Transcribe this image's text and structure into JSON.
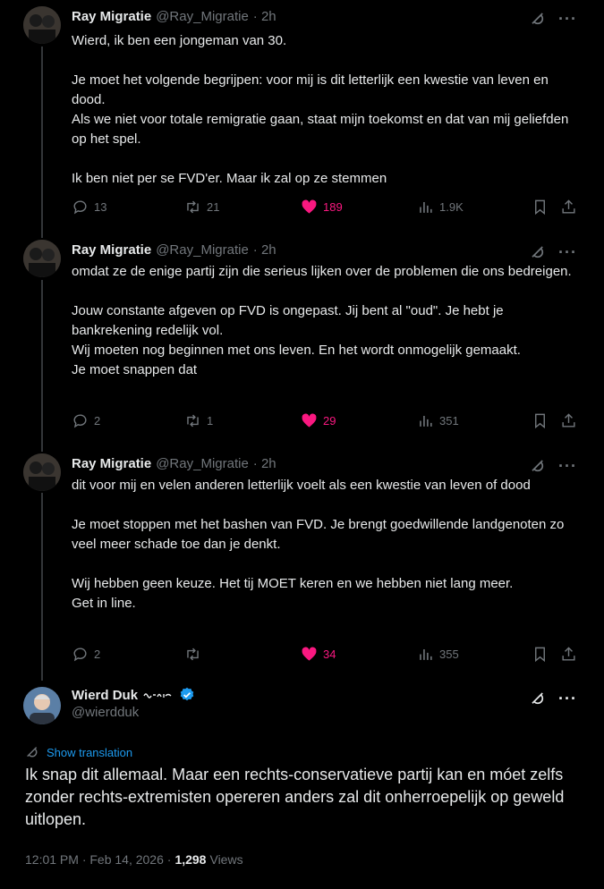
{
  "replies": [
    {
      "name": "Ray Migratie",
      "handle": "@Ray_Migratie",
      "time": "· 2h",
      "paragraphs": [
        "Wierd, ik ben een jongeman van 30.",
        "Je moet het volgende begrijpen: voor mij is dit letterlijk een kwestie van leven en dood.\nAls we niet voor totale remigratie gaan, staat mijn toekomst en dat van mij geliefden op het spel.",
        "Ik ben niet per se FVD'er. Maar ik zal op ze stemmen"
      ],
      "replies_count": "13",
      "reposts": "21",
      "likes": "189",
      "views": "1.9K"
    },
    {
      "name": "Ray Migratie",
      "handle": "@Ray_Migratie",
      "time": "· 2h",
      "paragraphs": [
        "omdat ze de enige partij zijn die serieus lijken over de problemen die ons bedreigen.",
        "Jouw constante afgeven op FVD is ongepast. Jij bent al \"oud\". Je hebt je bankrekening redelijk vol.\nWij moeten nog beginnen met ons leven. En het wordt onmogelijk gemaakt.\nJe moet snappen dat"
      ],
      "replies_count": "2",
      "reposts": "1",
      "likes": "29",
      "views": "351"
    },
    {
      "name": "Ray Migratie",
      "handle": "@Ray_Migratie",
      "time": "· 2h",
      "paragraphs": [
        "dit voor mij en velen anderen letterlijk voelt als een kwestie van leven of dood",
        "Je moet stoppen met het bashen van FVD. Je brengt goedwillende landgenoten zo veel meer schade toe dan je denkt.",
        "Wij hebben geen keuze. Het tij MOET keren en we hebben niet lang meer.\nGet in line."
      ],
      "replies_count": "2",
      "reposts": "",
      "likes": "34",
      "views": "355"
    }
  ],
  "main": {
    "name": "Wierd Duk",
    "handle": "@wierdduk",
    "show_translation": "Show translation",
    "text": "Ik snap dit allemaal. Maar een rechts-conservatieve partij kan en móet zelfs zonder rechts-extremisten opereren anders zal dit onherroepelijk op geweld uitlopen.",
    "time": "12:01 PM · Feb 14, 2026 ·",
    "views_count": "1,298",
    "views_label": "Views"
  },
  "colors": {
    "like": "#f91880",
    "muted": "#71767b",
    "link": "#1d9bf0",
    "verified": "#1d9bf0"
  },
  "icons": [
    "grok-icon",
    "more-icon",
    "reply-icon",
    "repost-icon",
    "heart-icon",
    "views-icon",
    "bookmark-icon",
    "share-icon",
    "verified-badge-icon",
    "translate-icon"
  ]
}
